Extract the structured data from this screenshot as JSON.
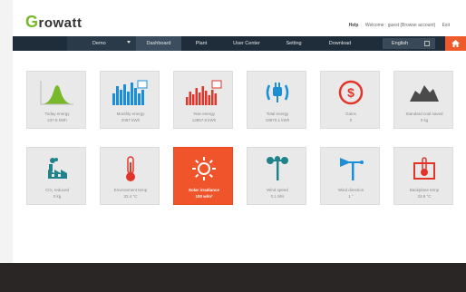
{
  "brand": {
    "logo_first": "G",
    "logo_rest": "rowatt"
  },
  "toplinks": {
    "help": "Help",
    "welcome": "Welcome : guest (Browse account)",
    "exit": "Exit"
  },
  "nav": {
    "plant_select": "Demo",
    "items": [
      "Dashboard",
      "Plant",
      "User Center",
      "Setting",
      "Download"
    ],
    "language": "English"
  },
  "colors": {
    "nav_bg": "#1f2d3a",
    "accent": "#f0542a",
    "brand_green": "#78b82a",
    "icon_blue": "#1b8fd6",
    "icon_red": "#e2352a",
    "icon_teal": "#20828a"
  },
  "cards_row1": [
    {
      "icon": "today-energy-chart-icon",
      "title": "Today energy",
      "value": "237.8 kWh"
    },
    {
      "icon": "monthly-energy-chart-icon",
      "title": "Monthly energy",
      "value": "2087 kWh"
    },
    {
      "icon": "year-energy-chart-icon",
      "title": "Year energy",
      "value": "13857.8 kWh"
    },
    {
      "icon": "total-energy-plug-icon",
      "title": "Total energy",
      "value": "19870.1 kWh"
    },
    {
      "icon": "gains-dollar-icon",
      "title": "Gains",
      "value": "0"
    },
    {
      "icon": "coal-saved-icon",
      "title": "Standard coal saved",
      "value": "0 kg"
    }
  ],
  "cards_row2": [
    {
      "icon": "co2-factory-icon",
      "title": "CO₂ reduced",
      "value": "0 kg"
    },
    {
      "icon": "thermometer-icon",
      "title": "Environment temp",
      "value": "32.4 °C"
    },
    {
      "icon": "sun-icon",
      "title": "Solar irradiance",
      "value": "100 w/m²"
    },
    {
      "icon": "wind-speed-icon",
      "title": "Wind speed",
      "value": "0.1 M/s"
    },
    {
      "icon": "wind-direction-icon",
      "title": "Wind direction",
      "value": "1 °"
    },
    {
      "icon": "backplane-temp-icon",
      "title": "Backplane temp",
      "value": "33.8 °C"
    }
  ]
}
